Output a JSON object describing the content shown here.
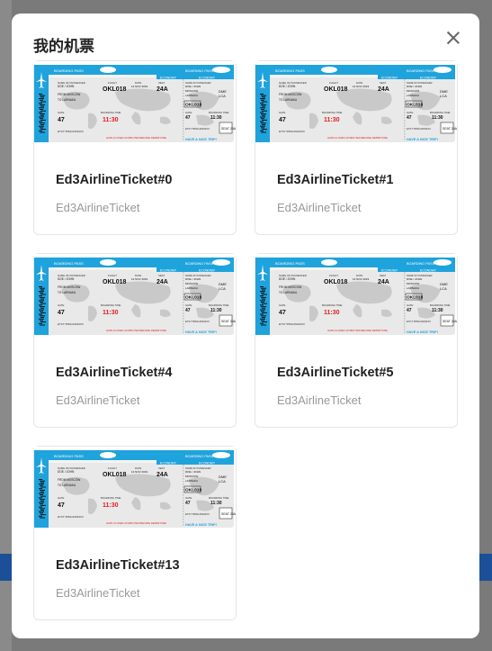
{
  "modal": {
    "title": "我的机票"
  },
  "ticket_image": {
    "header_left": "BOARDING PASS",
    "header_right": "BOARDING PASS",
    "economy": "ECONOMY",
    "name_label": "NAME OF PASSENGER",
    "name_value": "DOE / JOHN",
    "flight_label": "FLIGHT",
    "flight_value": "OKL018",
    "date_label": "DATE",
    "date_value": "12 NOV 2019",
    "seat_label": "SEAT",
    "seat_value": "24A",
    "from_label": "FROM",
    "from_value": "MOSCOW",
    "to_label": "TO",
    "to_value": "LARNAKA",
    "code_from": "DME",
    "code_to": "LCA",
    "gate_label": "GATE",
    "gate_value": "47",
    "boarding_label": "BOARDING TIME",
    "boarding_value": "11:30",
    "ticket_no": "ETKT 5552115294XX",
    "warning": "GATE CLOSES 40 MINUTES BEFORE DEPARTURE",
    "nice_trip": "HAVE A NICE TRIP!",
    "seat_stub": "SEAT 24A",
    "accent": "#1fa3dc",
    "red": "#e02020"
  },
  "tickets": [
    {
      "title": "Ed3AirlineTicket#0",
      "subtitle": "Ed3AirlineTicket"
    },
    {
      "title": "Ed3AirlineTicket#1",
      "subtitle": "Ed3AirlineTicket"
    },
    {
      "title": "Ed3AirlineTicket#4",
      "subtitle": "Ed3AirlineTicket"
    },
    {
      "title": "Ed3AirlineTicket#5",
      "subtitle": "Ed3AirlineTicket"
    },
    {
      "title": "Ed3AirlineTicket#13",
      "subtitle": "Ed3AirlineTicket"
    }
  ]
}
